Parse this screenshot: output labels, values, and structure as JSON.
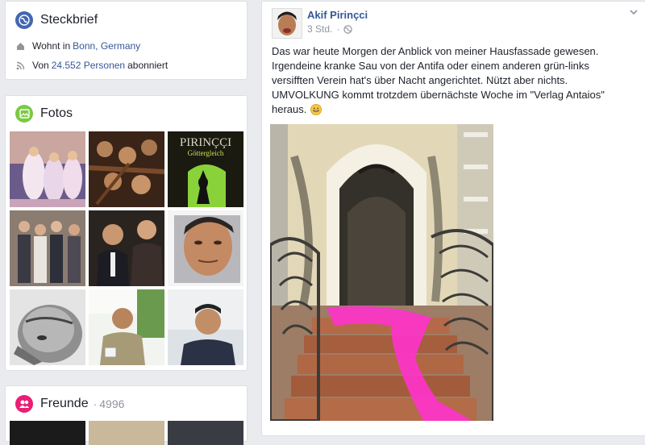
{
  "intro": {
    "title": "Steckbrief",
    "lives_prefix": "Wohnt in",
    "lives_city": "Bonn, Germany",
    "followers_prefix": "Von",
    "followers_count": "24.552 Personen",
    "followers_suffix": "abonniert"
  },
  "photos": {
    "title": "Fotos"
  },
  "friends": {
    "title": "Freunde",
    "count": "4996"
  },
  "post": {
    "author": "Akif Pirinçci",
    "time": "3 Std.",
    "text_lines": [
      "Das war heute Morgen der Anblick von meiner Hausfassade gewesen.",
      "Irgendeine kranke Sau von der Antifa oder einem anderen grün-links",
      "versifften Verein hat's über Nacht angerichtet. Nützt aber nichts.",
      "UMVOLKUNG kommt trotzdem übernächste Woche im \"Verlag Antaios\"",
      "heraus."
    ],
    "book_title": "PIRINÇÇI",
    "book_subtitle": "Göttergleich"
  },
  "colors": {
    "link": "#365899",
    "intro_icon": "#4267b2",
    "photos_icon": "#7ac943",
    "friends_icon": "#e91e75",
    "paint": "#ff33cc"
  }
}
